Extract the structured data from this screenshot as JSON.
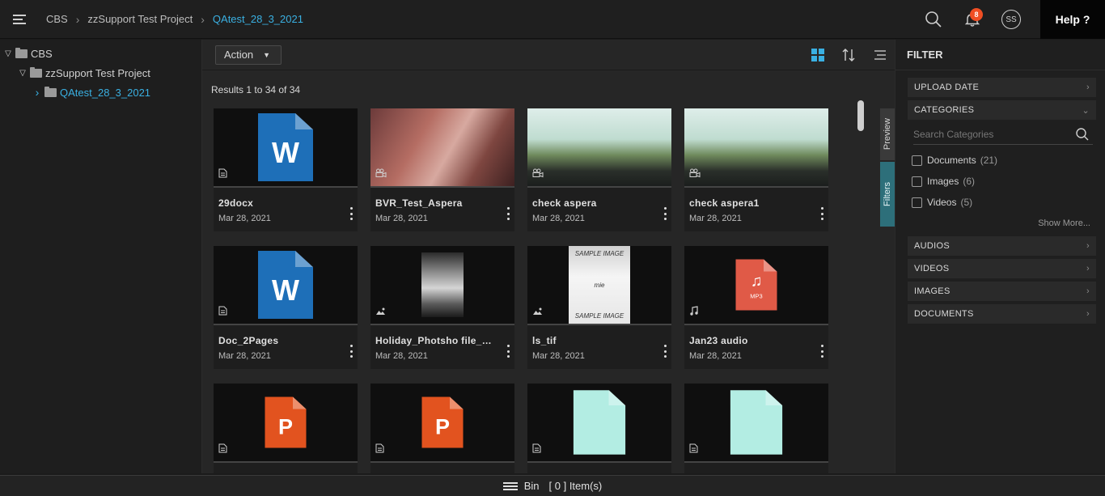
{
  "breadcrumb": [
    "CBS",
    "zzSupport Test Project",
    "QAtest_28_3_2021"
  ],
  "header": {
    "notification_count": "8",
    "avatar_initials": "SS",
    "help_label": "Help ?"
  },
  "tree": [
    {
      "label": "CBS",
      "arrow": "▽"
    },
    {
      "label": "zzSupport Test Project",
      "arrow": "▽"
    },
    {
      "label": "QAtest_28_3_2021",
      "arrow": "›"
    }
  ],
  "toolbar": {
    "action_label": "Action"
  },
  "results_text": "Results 1 to 34 of 34",
  "assets": [
    {
      "title": "29docx",
      "date": "Mar 28, 2021",
      "type": "document",
      "thumb": "word"
    },
    {
      "title": "BVR_Test_Aspera",
      "date": "Mar 28, 2021",
      "type": "video",
      "thumb": "video-a"
    },
    {
      "title": "check aspera",
      "date": "Mar 28, 2021",
      "type": "video",
      "thumb": "video-b"
    },
    {
      "title": "check aspera1",
      "date": "Mar 28, 2021",
      "type": "video",
      "thumb": "video-b"
    },
    {
      "title": "Doc_2Pages",
      "date": "Mar 28, 2021",
      "type": "document",
      "thumb": "word"
    },
    {
      "title": "Holiday_Photsho file_Te...",
      "date": "Mar 28, 2021",
      "type": "image",
      "thumb": "screenshot"
    },
    {
      "title": "ls_tif",
      "date": "Mar 28, 2021",
      "type": "image",
      "thumb": "sample"
    },
    {
      "title": "Jan23 audio",
      "date": "Mar 28, 2021",
      "type": "audio",
      "thumb": "mp3"
    },
    {
      "title": "",
      "date": "",
      "type": "document",
      "thumb": "ppt"
    },
    {
      "title": "",
      "date": "",
      "type": "document",
      "thumb": "ppt"
    },
    {
      "title": "",
      "date": "",
      "type": "document",
      "thumb": "generic"
    },
    {
      "title": "",
      "date": "",
      "type": "document",
      "thumb": "generic"
    }
  ],
  "thumb_text": {
    "word_letter": "W",
    "ppt_letter": "P",
    "mp3_label": "MP3",
    "sample_top": "SAMPLE IMAGE",
    "sample_mid": "mie",
    "sample_bottom": "SAMPLE IMAGE"
  },
  "side_tabs": {
    "preview": "Preview",
    "filters": "Filters"
  },
  "filter": {
    "title": "FILTER",
    "upload_date": "UPLOAD DATE",
    "categories": "CATEGORIES",
    "search_placeholder": "Search Categories",
    "options": [
      {
        "label": "Documents",
        "count": "(21)"
      },
      {
        "label": "Images",
        "count": "(6)"
      },
      {
        "label": "Videos",
        "count": "(5)"
      }
    ],
    "show_more": "Show More...",
    "sections": [
      "AUDIOS",
      "VIDEOS",
      "IMAGES",
      "DOCUMENTS"
    ]
  },
  "bin": {
    "label": "Bin",
    "count_text": "[ 0 ] Item(s)"
  },
  "colors": {
    "accent": "#3ab0e2",
    "badge": "#f04e23",
    "word": "#1e6fb8",
    "ppt": "#e2531f",
    "mp3": "#e05a47",
    "generic": "#b3ede3",
    "filters_tab": "#2d6f7a"
  }
}
